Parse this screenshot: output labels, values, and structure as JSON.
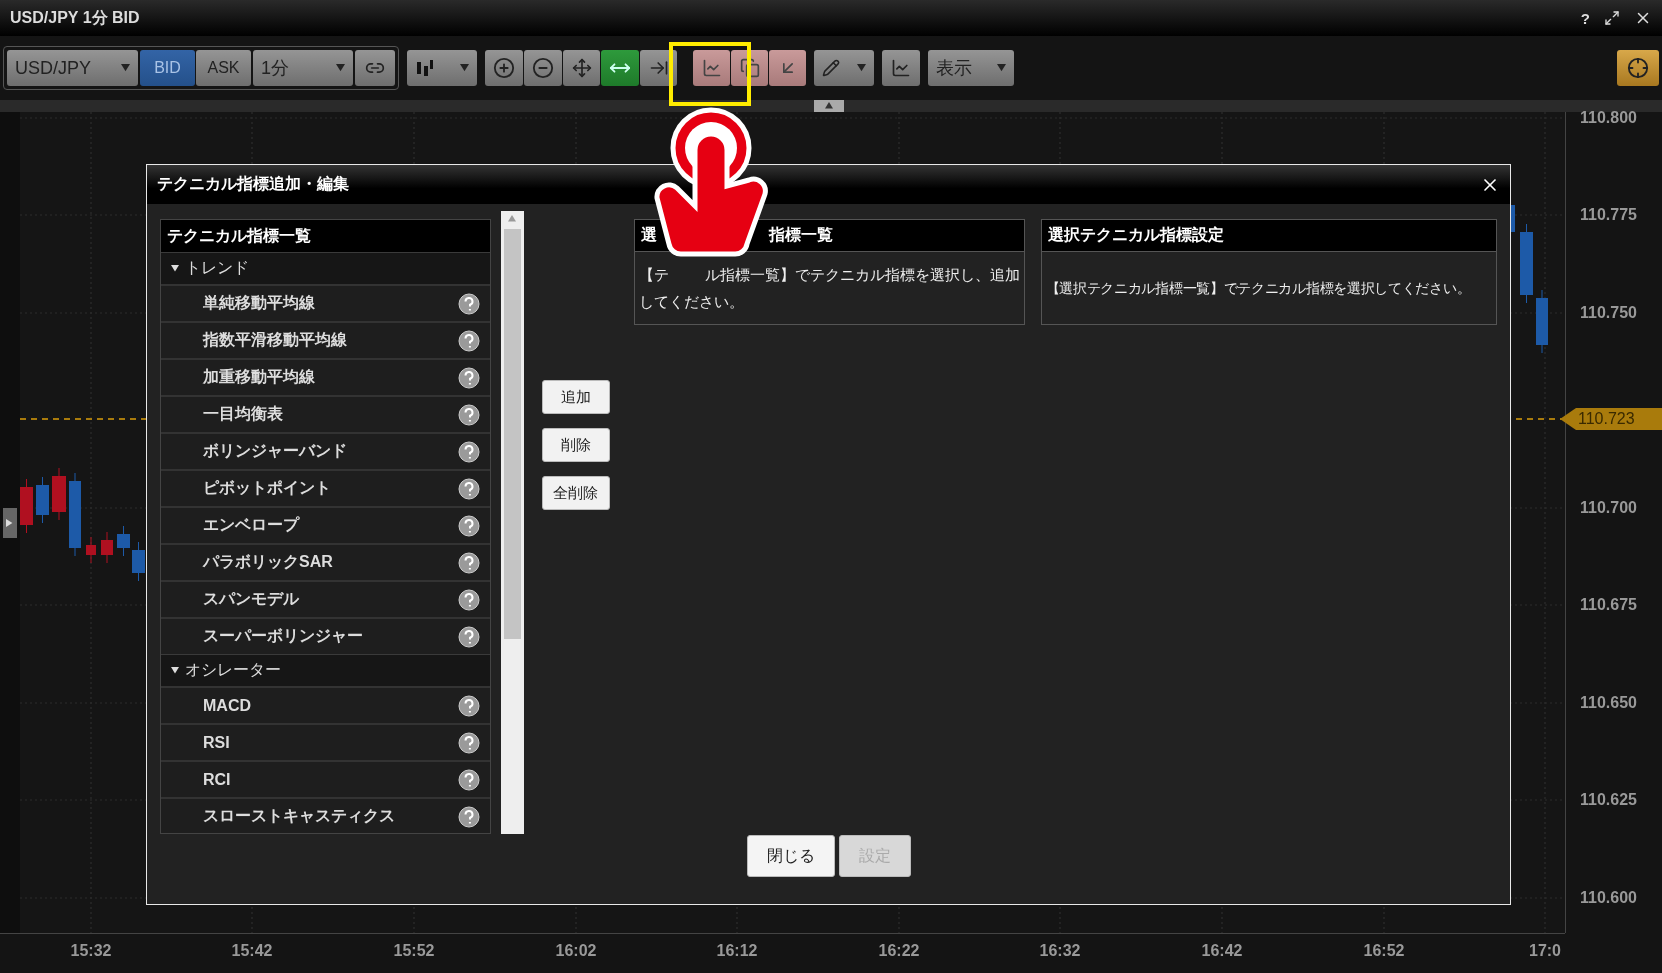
{
  "window": {
    "title": "USD/JPY 1分 BID",
    "help": "?"
  },
  "toolbar": {
    "symbol": "USD/JPY",
    "sides": [
      {
        "label": "BID",
        "selected": true
      },
      {
        "label": "ASK",
        "selected": false
      }
    ],
    "interval": "1分",
    "tools": [
      {
        "kind": "zoom-in",
        "active": false,
        "highlighted": false
      },
      {
        "kind": "zoom-out",
        "active": false,
        "highlighted": false
      },
      {
        "kind": "fit",
        "active": false,
        "highlighted": false
      },
      {
        "kind": "fit-width",
        "active": true,
        "highlighted": false
      },
      {
        "kind": "scroll-end",
        "active": false,
        "highlighted": false
      },
      {
        "kind": "add-indicator",
        "active": false,
        "highlighted": true
      },
      {
        "kind": "copy-indicator",
        "active": false,
        "highlighted": true
      },
      {
        "kind": "export",
        "active": false,
        "highlighted": true
      }
    ],
    "view_menu": "表示"
  },
  "chart": {
    "price_labels": [
      "110.800",
      "110.775",
      "110.750",
      "110.700",
      "110.675",
      "110.650",
      "110.625",
      "110.600"
    ],
    "current_price": "110.723",
    "time_labels": [
      "15:32",
      "15:42",
      "15:52",
      "16:02",
      "16:12",
      "16:22",
      "16:32",
      "16:42",
      "16:52",
      "17:0"
    ]
  },
  "dialog": {
    "title": "テクニカル指標追加・編集",
    "list": {
      "title": "テクニカル指標一覧",
      "groups": [
        {
          "label": "トレンド",
          "expanded": true,
          "children": [
            {
              "label": "単純移動平均線"
            },
            {
              "label": "指数平滑移動平均線"
            },
            {
              "label": "加重移動平均線"
            },
            {
              "label": "一目均衡表"
            },
            {
              "label": "ボリンジャーバンド"
            },
            {
              "label": "ピボットポイント"
            },
            {
              "label": "エンベロープ"
            },
            {
              "label": "パラボリックSAR"
            },
            {
              "label": "スパンモデル"
            },
            {
              "label": "スーパーボリンジャー"
            }
          ]
        },
        {
          "label": "オシレーター",
          "expanded": true,
          "children": [
            {
              "label": "MACD"
            },
            {
              "label": "RSI"
            },
            {
              "label": "RCI"
            },
            {
              "label": "スローストキャスティクス"
            }
          ]
        }
      ]
    },
    "actions": [
      "追加",
      "削除",
      "全削除"
    ],
    "selected_panel": {
      "title_parts": [
        "選",
        "指標一覧"
      ],
      "message_parts": [
        "【テ",
        "ル指標一覧】でテクニカル指標を選択し、追加",
        "してください。"
      ]
    },
    "settings_panel": {
      "title": "選択テクニカル指標設定",
      "message": "【選択テクニカル指標一覧】でテクニカル指標を選択してください。"
    },
    "footer_buttons": [
      {
        "label": "閉じる",
        "disabled": false
      },
      {
        "label": "設定",
        "disabled": true
      }
    ]
  }
}
